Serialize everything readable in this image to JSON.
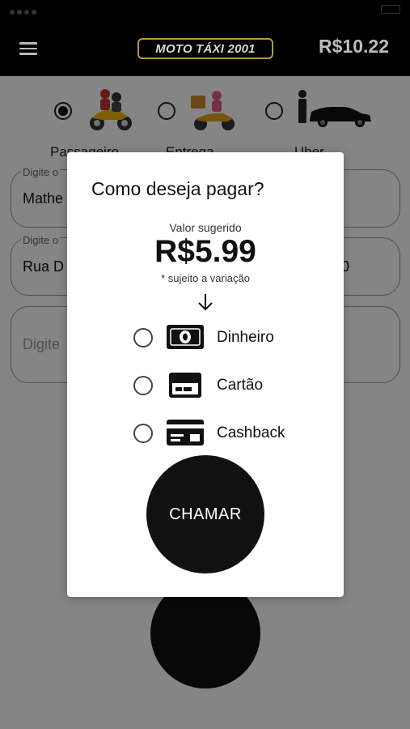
{
  "header": {
    "logo_text": "MOTO TÁXI 2001",
    "balance": "R$10.22"
  },
  "services": [
    {
      "label": "Passageiro",
      "selected": true,
      "icon": "motorcycle-passenger-icon"
    },
    {
      "label": "Entrega",
      "selected": false,
      "icon": "delivery-scooter-icon"
    },
    {
      "label": "Uber",
      "selected": false,
      "icon": "car-driver-icon"
    }
  ],
  "form": {
    "origin_label": "Digite o",
    "origin_value": "Mathe",
    "destination_label": "Digite o",
    "destination_value": "Rua D",
    "destination_suffix": "0",
    "notes_placeholder": "Digite"
  },
  "modal": {
    "title": "Como deseja pagar?",
    "suggested_label": "Valor sugerido",
    "price": "R$5.99",
    "note": "* sujeito a variação",
    "options": [
      {
        "label": "Dinheiro",
        "icon": "cash-icon",
        "selected": false
      },
      {
        "label": "Cartão",
        "icon": "credit-card-icon",
        "selected": false
      },
      {
        "label": "Cashback",
        "icon": "cashback-card-icon",
        "selected": false
      }
    ],
    "call_button": "CHAMAR"
  },
  "colors": {
    "header_bg": "#000000",
    "logo_border": "#b59a3a",
    "overlay": "rgba(0,0,0,0.48)",
    "button_bg": "#111111"
  }
}
